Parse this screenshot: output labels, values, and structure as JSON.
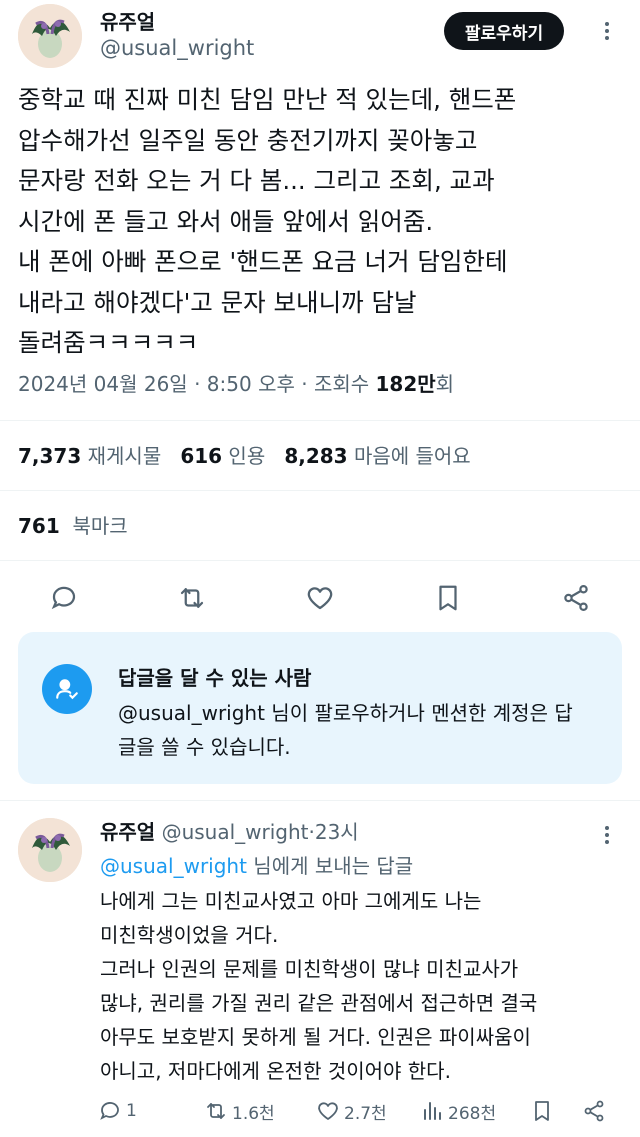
{
  "author": {
    "name": "유주얼",
    "handle": "@usual_wright",
    "follow_label": "팔로우하기"
  },
  "tweet": {
    "text": "중학교 때 진짜 미친 담임 만난 적 있는데, 핸드폰\n압수해가선 일주일 동안 충전기까지 꽂아놓고\n문자랑 전화 오는 거 다 봄... 그리고 조회, 교과\n시간에 폰 들고 와서 애들 앞에서 읽어줌.\n내 폰에 아빠 폰으로 '핸드폰 요금 너거 담임한테\n내라고 해야겠다'고 문자 보내니까 담날\n돌려줌ㅋㅋㅋㅋㅋ",
    "date": "2024년 04월 26일",
    "dot1": "·",
    "time": "8:50 오후",
    "dot2": "·",
    "views_label": "조회수",
    "views_value": "182만",
    "views_suffix": "회"
  },
  "stats": {
    "retweets_value": "7,373",
    "retweets_label": "재게시물",
    "quotes_value": "616",
    "quotes_label": "인용",
    "likes_value": "8,283",
    "likes_label": "마음에 들어요",
    "bookmarks_value": "761",
    "bookmarks_label": "북마크"
  },
  "actions": {
    "icons": [
      "reply-icon",
      "retweet-icon",
      "like-icon",
      "bookmark-icon",
      "share-icon"
    ]
  },
  "reply_card": {
    "title": "답글을 달 수 있는 사람",
    "body": "@usual_wright 님이 팔로우하거나 멘션한 계정은 답글을 쓸 수 있습니다."
  },
  "reply": {
    "name": "유주얼",
    "handle": "@usual_wright",
    "dot": "·",
    "time": "23시",
    "reply_to_mention": "@usual_wright",
    "reply_to_suffix": " 님에게 보내는 답글",
    "text": "나에게 그는 미친교사였고 아마 그에게도 나는\n미친학생이었을 거다.\n그러나 인권의 문제를 미친학생이 많냐 미친교사가\n많냐, 권리를 가질 권리 같은 관점에서 접근하면 결국\n아무도 보호받지 못하게 될 거다. 인권은 파이싸움이\n아니고, 저마다에게 온전한 것이어야 한다.",
    "reply_count": "1",
    "retweet_count": "1.6천",
    "like_count": "2.7천",
    "view_count": "268천"
  },
  "colors": {
    "accent": "#1d9bf0",
    "text": "#0f1419",
    "muted": "#536471",
    "card_bg": "#e8f5fd"
  }
}
